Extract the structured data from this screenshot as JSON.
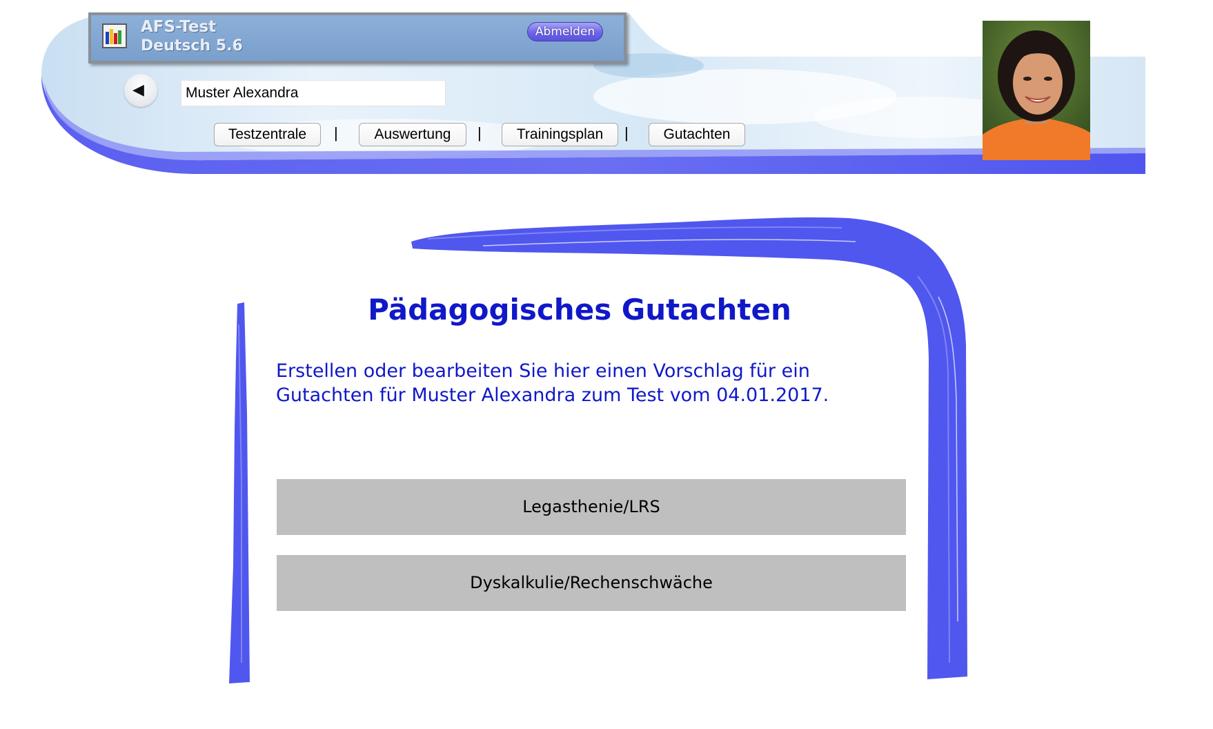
{
  "header": {
    "app_title_line1": "AFS-Test",
    "app_title_line2": "Deutsch 5.6",
    "logout_label": "Abmelden",
    "student_name": "Muster Alexandra",
    "nav": [
      {
        "label": "Testzentrale"
      },
      {
        "label": "Auswertung"
      },
      {
        "label": "Trainingsplan"
      },
      {
        "label": "Gutachten"
      }
    ],
    "nav_separator": "|"
  },
  "main": {
    "title": "Pädagogisches Gutachten",
    "intro_line1": "Erstellen oder bearbeiten Sie hier einen Vorschlag für ein",
    "intro_line2": "Gutachten für Muster Alexandra zum Test vom 04.01.2017.",
    "buttons": [
      {
        "label": "Legasthenie/LRS"
      },
      {
        "label": "Dyskalkulie/Rechenschwäche"
      }
    ]
  },
  "colors": {
    "accent_blue": "#1018c8",
    "brush_blue": "#5057ee",
    "button_gray": "#bfbfbf"
  },
  "icons": {
    "back": "left-triangle-icon",
    "app": "bar-chart-icon"
  }
}
